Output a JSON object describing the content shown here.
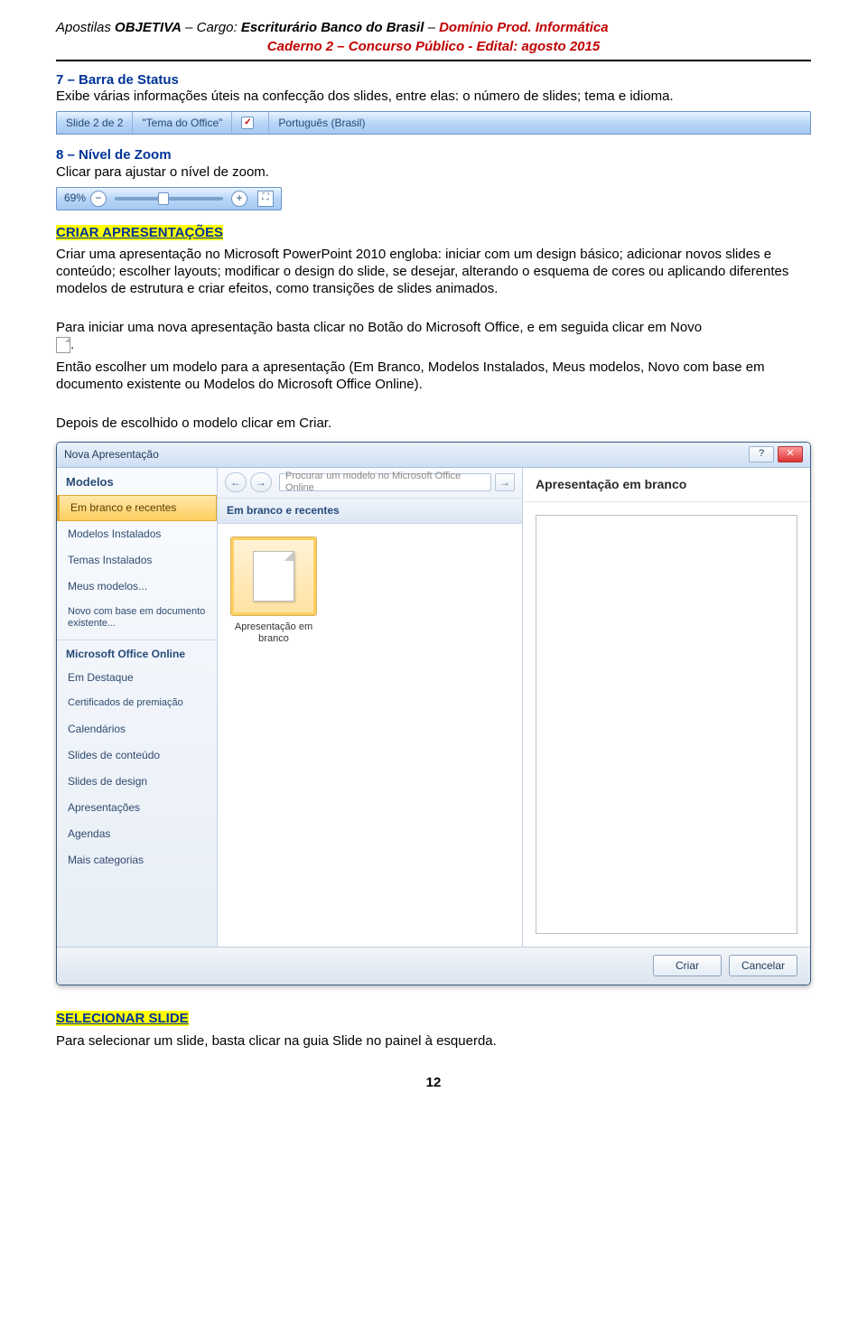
{
  "header": {
    "line1_pre": "Apostilas ",
    "brand1": "OBJETIVA",
    "mid1": " – Cargo: ",
    "role": "Escriturário ",
    "brand2": "Banco do Brasil",
    "post1": " – ",
    "domain": "Domínio Prod. Informática",
    "line2": "Caderno 2 – Concurso Público - Edital:  agosto 2015"
  },
  "sec7": {
    "title": "7 – Barra de Status",
    "body": "Exibe várias informações úteis na confecção dos slides, entre elas: o número de slides; tema e idioma."
  },
  "statusbar": {
    "slide": "Slide 2 de 2",
    "theme": "\"Tema do Office\"",
    "lang": "Português (Brasil)"
  },
  "sec8": {
    "title": "8 – Nível de Zoom",
    "body": "Clicar para ajustar o nível de zoom."
  },
  "zoom": {
    "pct": "69%"
  },
  "criar": {
    "title": "CRIAR APRESENTAÇÕES",
    "p1": "Criar uma apresentação no Microsoft PowerPoint 2010 engloba: iniciar com um design básico; adicionar novos slides e conteúdo; escolher layouts; modificar o design do slide, se desejar, alterando o esquema de cores ou aplicando diferentes modelos de estrutura e criar efeitos, como transições de slides animados.",
    "p2": "Para iniciar uma nova apresentação basta clicar no Botão do Microsoft Office, e em seguida clicar em Novo ",
    "p3": "Então escolher um modelo para a apresentação (Em Branco, Modelos Instalados, Meus modelos, Novo com base em documento existente ou Modelos do Microsoft Office Online).",
    "p4": "Depois de escolhido o modelo clicar em Criar."
  },
  "dialog": {
    "title": "Nova Apresentação",
    "side_header": "Modelos",
    "items": [
      "Em branco e recentes",
      "Modelos Instalados",
      "Temas Instalados",
      "Meus modelos...",
      "Novo com base em documento existente..."
    ],
    "sub_header": "Microsoft Office Online",
    "sub_items": [
      "Em Destaque",
      "Certificados de premiação",
      "Calendários",
      "Slides de conteúdo",
      "Slides de design",
      "Apresentações",
      "Agendas",
      "Mais categorias"
    ],
    "search_placeholder": "Procurar um modelo no Microsoft Office Online",
    "mid_header": "Em branco e recentes",
    "thumb_label": "Apresentação em branco",
    "right_header": "Apresentação em branco",
    "btn_create": "Criar",
    "btn_cancel": "Cancelar"
  },
  "sel": {
    "title": "SELECIONAR SLIDE",
    "body": "Para selecionar um slide, basta clicar na guia Slide no painel à esquerda."
  },
  "page_num": "12"
}
